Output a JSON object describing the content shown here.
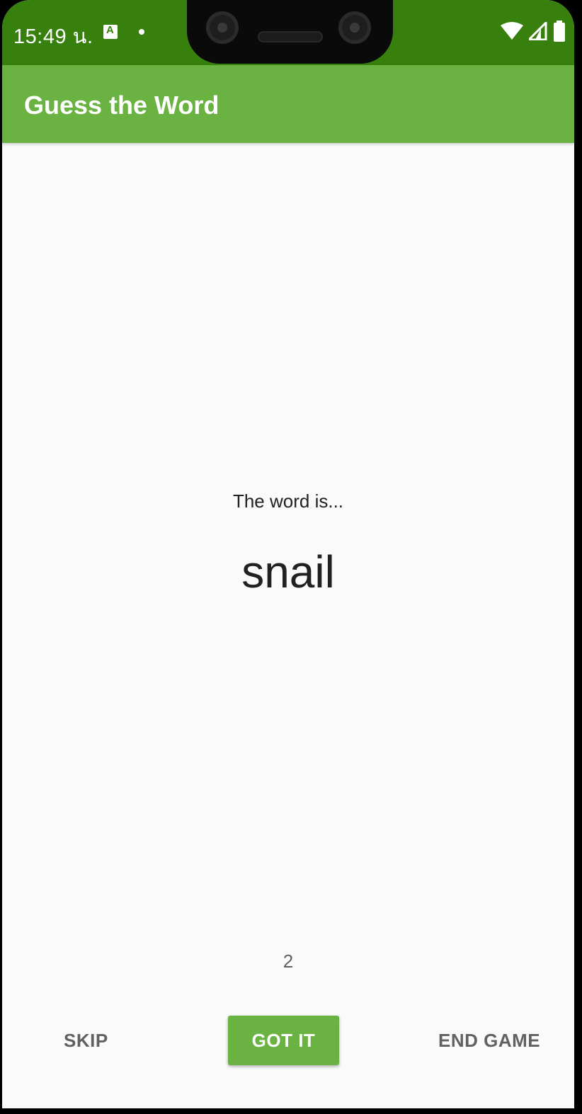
{
  "status_bar": {
    "time": "15:49 น.",
    "notification_icon_letter": "A",
    "icons": [
      "wifi-icon",
      "cell-signal-icon",
      "battery-icon"
    ]
  },
  "app_bar": {
    "title": "Guess the Word"
  },
  "game": {
    "word_label": "The word is...",
    "word": "snail",
    "score": "2"
  },
  "buttons": {
    "skip": "SKIP",
    "got_it": "GOT IT",
    "end_game": "END GAME"
  },
  "colors": {
    "status_bar": "#38800E",
    "app_bar": "#6AB343",
    "accent": "#6AB343",
    "background": "#FAFAFA"
  }
}
